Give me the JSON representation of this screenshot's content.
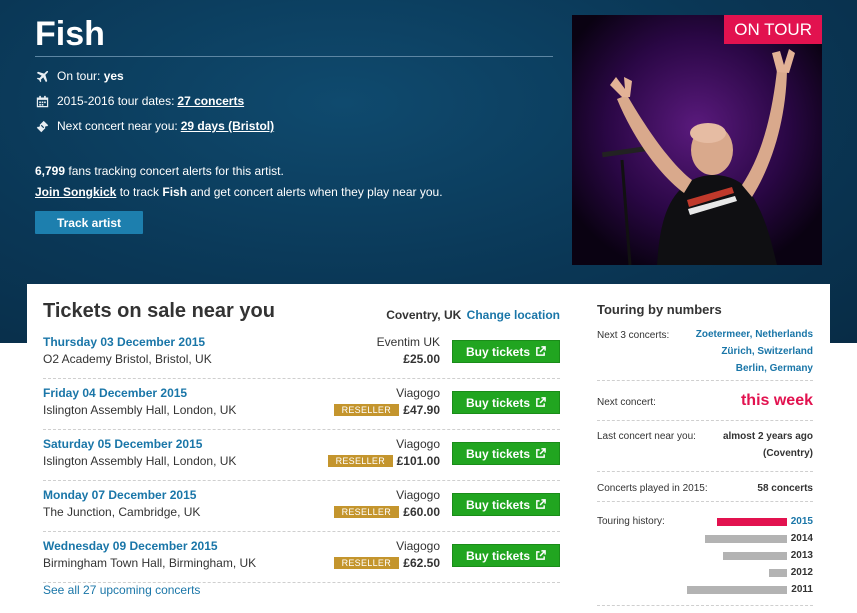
{
  "artist": {
    "name": "Fish",
    "on_tour_label": "On tour:",
    "on_tour_value": "yes",
    "tour_dates_label": "2015-2016 tour dates:",
    "tour_dates_link": "27 concerts",
    "next_concert_label": "Next concert near you:",
    "next_concert_link": "29 days (Bristol)",
    "fans_count": "6,799",
    "fans_text": " fans tracking concert alerts for this artist.",
    "join_link": "Join Songkick",
    "join_text_1": " to track ",
    "join_artist": "Fish",
    "join_text_2": " and get concert alerts when they play near you.",
    "track_button": "Track artist",
    "badge": "ON TOUR",
    "icons": [
      "plane-icon",
      "calendar-icon",
      "ticket-icon"
    ]
  },
  "tickets": {
    "title": "Tickets on sale near you",
    "location": "Coventry, UK",
    "change_location": "Change location",
    "buy_label": "Buy tickets",
    "reseller_label": "RESELLER",
    "rows": [
      {
        "date": "Thursday 03 December 2015",
        "venue": "O2 Academy Bristol, Bristol, UK",
        "vendor": "Eventim UK",
        "price": "£25.00",
        "reseller": false
      },
      {
        "date": "Friday 04 December 2015",
        "venue": "Islington Assembly Hall, London, UK",
        "vendor": "Viagogo",
        "price": "£47.90",
        "reseller": true
      },
      {
        "date": "Saturday 05 December 2015",
        "venue": "Islington Assembly Hall, London, UK",
        "vendor": "Viagogo",
        "price": "£101.00",
        "reseller": true
      },
      {
        "date": "Monday 07 December 2015",
        "venue": "The Junction, Cambridge, UK",
        "vendor": "Viagogo",
        "price": "£60.00",
        "reseller": true
      },
      {
        "date": "Wednesday 09 December 2015",
        "venue": "Birmingham Town Hall, Birmingham, UK",
        "vendor": "Viagogo",
        "price": "£62.50",
        "reseller": true
      }
    ],
    "see_all": "See all 27 upcoming concerts"
  },
  "stats": {
    "title": "Touring by numbers",
    "next3_label": "Next 3 concerts:",
    "next3": [
      "Zoetermeer, Netherlands",
      "Zürich, Switzerland",
      "Berlin, Germany"
    ],
    "next_concert_label": "Next concert:",
    "next_concert_value": "this week",
    "last_near_label": "Last concert near you:",
    "last_near_value": "almost 2 years ago",
    "last_near_place": "(Coventry)",
    "played_label": "Concerts played in 2015:",
    "played_value": "58 concerts",
    "history_label": "Touring history:",
    "history": [
      {
        "year": "2015",
        "relative": 1.0,
        "active": true
      },
      {
        "year": "2014",
        "relative": 1.17,
        "active": false
      },
      {
        "year": "2013",
        "relative": 0.92,
        "active": false
      },
      {
        "year": "2012",
        "relative": 0.26,
        "active": false
      },
      {
        "year": "2011",
        "relative": 1.43,
        "active": false
      }
    ]
  },
  "colors": {
    "hero_bg": "#0a3756",
    "accent_pink": "#e2124f",
    "link_blue": "#1a76a8",
    "buy_green": "#21a520",
    "reseller_gold": "#c4952d"
  }
}
